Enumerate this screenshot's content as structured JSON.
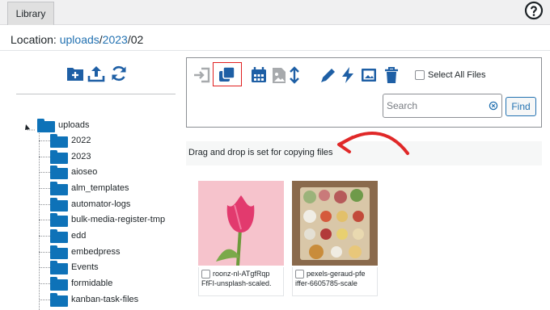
{
  "header": {
    "tab_label": "Library",
    "help_icon": "question-circle-icon"
  },
  "location": {
    "prefix": "Location:",
    "parts": [
      "uploads",
      "2023",
      "02"
    ],
    "sep": "/"
  },
  "left_toolbar": {
    "icons": [
      "new-folder-icon",
      "upload-icon",
      "refresh-icon"
    ]
  },
  "tree": {
    "root": "uploads",
    "items": [
      "2022",
      "2023",
      "aioseo",
      "alm_templates",
      "automator-logs",
      "bulk-media-register-tmp",
      "edd",
      "embedpress",
      "Events",
      "formidable",
      "kanban-task-files"
    ]
  },
  "toolbar": {
    "icons": [
      "move-icon",
      "copy-icon",
      "calendar-icon",
      "image-icon",
      "sort-icon",
      "edit-icon",
      "bolt-icon",
      "gallery-icon",
      "trash-icon"
    ],
    "select_all_label": "Select All Files",
    "search_placeholder": "Search",
    "search_value": "",
    "find_label": "Find",
    "accent": "#1e5fa5"
  },
  "dnd_message": "Drag and drop is set for copying files",
  "files": [
    {
      "line1": "roonz-nl-ATgfRqp",
      "line2": "FfFI-unsplash-scaled."
    },
    {
      "line1": "pexels-geraud-pfe",
      "line2": "iffer-6605785-scale"
    }
  ]
}
